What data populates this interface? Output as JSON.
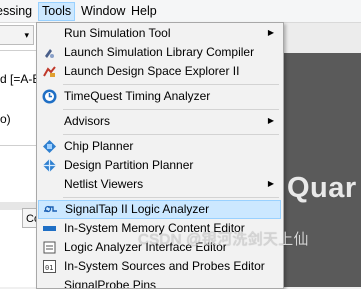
{
  "menubar": {
    "items": [
      {
        "label": "essing"
      },
      {
        "label": "Tools"
      },
      {
        "label": "Window"
      },
      {
        "label": "Help"
      }
    ]
  },
  "left_pane": {
    "combo_arrow": "▾",
    "line1": "d [=A-E",
    "line2": "o)",
    "tab_label": "Co"
  },
  "brand_text": "Quar",
  "tools_menu": {
    "items": [
      {
        "label": "Run Simulation Tool",
        "icon": "none",
        "submenu": true
      },
      {
        "label": "Launch Simulation Library Compiler",
        "icon": "library-compiler-icon"
      },
      {
        "label": "Launch Design Space Explorer II",
        "icon": "design-space-explorer-icon"
      },
      {
        "label": "TimeQuest Timing Analyzer",
        "icon": "timequest-icon"
      },
      {
        "label": "Advisors",
        "icon": "none",
        "submenu": true
      },
      {
        "label": "Chip Planner",
        "icon": "chip-planner-icon"
      },
      {
        "label": "Design Partition Planner",
        "icon": "partition-planner-icon"
      },
      {
        "label": "Netlist Viewers",
        "icon": "none",
        "submenu": true
      },
      {
        "label": "SignalTap II Logic Analyzer",
        "icon": "signaltap-icon",
        "highlighted": true
      },
      {
        "label": "In-System Memory Content Editor",
        "icon": "memory-editor-icon"
      },
      {
        "label": "Logic Analyzer Interface Editor",
        "icon": "lai-editor-icon"
      },
      {
        "label": "In-System Sources and Probes Editor",
        "icon": "sources-probes-icon"
      },
      {
        "label": "SignalProbe Pins",
        "icon": "none"
      }
    ],
    "submenu_arrow": "▶"
  },
  "watermark": "CSDN @银河洗剑天上仙",
  "colors": {
    "highlight_bg": "#cce8ff",
    "highlight_border": "#99d1ff",
    "menu_bg": "#f2f2f2",
    "dark_area": "#5a5a5a"
  }
}
